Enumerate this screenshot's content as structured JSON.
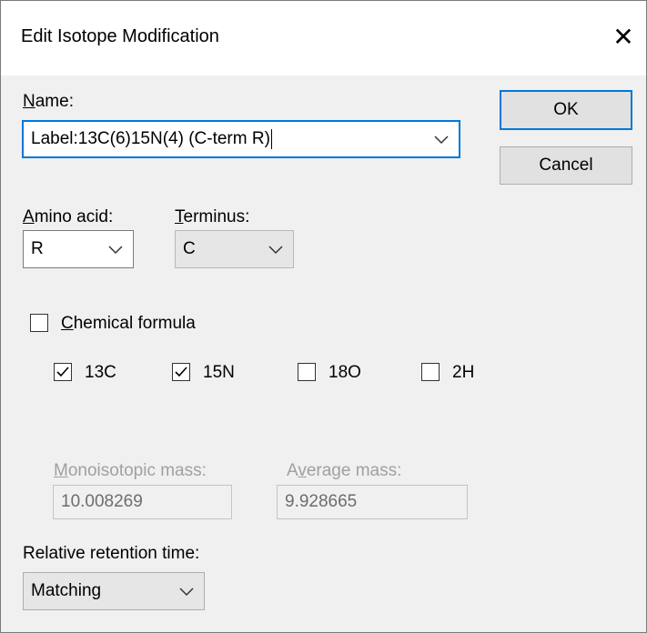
{
  "window": {
    "title": "Edit Isotope Modification",
    "close_icon": "close-icon"
  },
  "name": {
    "label_u": "N",
    "label_rest": "ame:",
    "value": "Label:13C(6)15N(4) (C-term R)"
  },
  "buttons": {
    "ok": "OK",
    "cancel": "Cancel"
  },
  "amino_acid": {
    "label_u": "A",
    "label_rest": "mino acid:",
    "value": "R"
  },
  "terminus": {
    "label_u": "T",
    "label_rest": "erminus:",
    "value": "C"
  },
  "chemical_formula": {
    "label_u": "C",
    "label_rest": "hemical formula",
    "checked": false
  },
  "isotopes": [
    {
      "label": "13C",
      "checked": true
    },
    {
      "label": "15N",
      "checked": true
    },
    {
      "label": "18O",
      "checked": false
    },
    {
      "label": "2H",
      "checked": false
    }
  ],
  "mono_mass": {
    "label_u": "M",
    "label_rest": "onoisotopic mass:",
    "value": "10.008269"
  },
  "avg_mass": {
    "label_pre": "A",
    "label_u": "v",
    "label_rest": "erage mass:",
    "value": "9.928665"
  },
  "retention": {
    "label": "Relative retention time:",
    "value": "Matching"
  }
}
